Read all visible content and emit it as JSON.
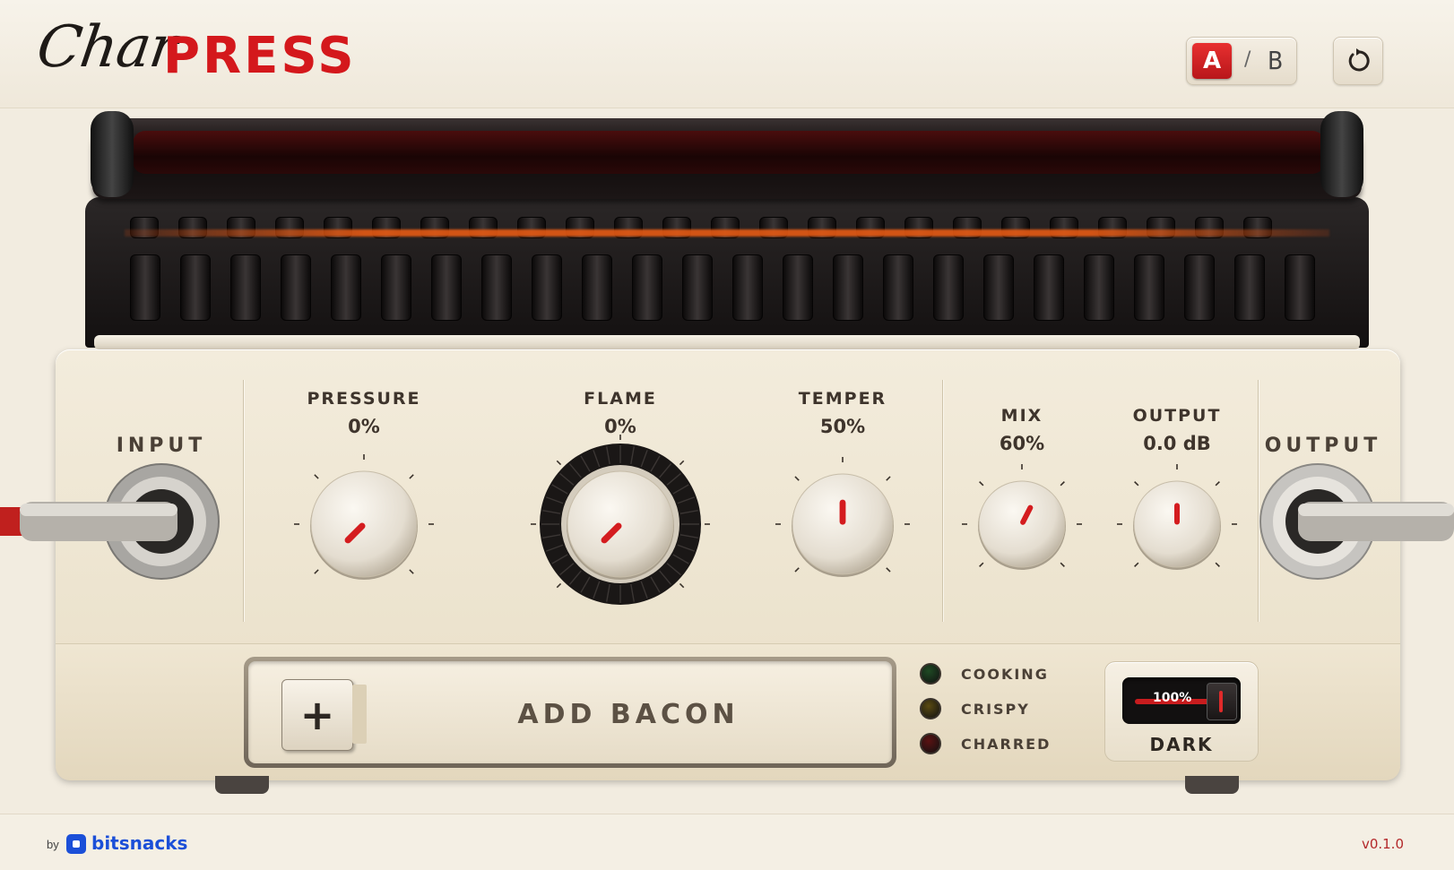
{
  "header": {
    "logo_script": "Char",
    "logo_bold": "PRESS",
    "ab": {
      "a_label": "A",
      "divider": "/",
      "b_label": "B",
      "selected": "A"
    },
    "reset_icon": "reset-icon"
  },
  "panel": {
    "input_label": "INPUT",
    "output_label": "OUTPUT",
    "knobs": {
      "pressure": {
        "label": "PRESSURE",
        "value": "0%",
        "fraction": 0.0
      },
      "flame": {
        "label": "FLAME",
        "value": "0%",
        "fraction": 0.0
      },
      "temper": {
        "label": "TEMPER",
        "value": "50%",
        "fraction": 0.5
      },
      "mix": {
        "label": "MIX",
        "value": "60%",
        "fraction": 0.6
      },
      "output": {
        "label": "OUTPUT",
        "value": "0.0 dB",
        "fraction": 0.5
      }
    },
    "add_bacon": {
      "icon": "plus-icon",
      "plus_glyph": "+",
      "label": "ADD BACON"
    },
    "status": {
      "cooking": {
        "label": "COOKING",
        "color": "#1f4a24"
      },
      "crispy": {
        "label": "CRISPY",
        "color": "#5a4a12"
      },
      "charred": {
        "label": "CHARRED",
        "color": "#5a1212"
      }
    },
    "dark": {
      "value": "100%",
      "fraction": 1.0,
      "label": "DARK"
    }
  },
  "colors": {
    "accent": "#d4181c",
    "brand": "#1b4fd8"
  },
  "footer": {
    "by": "by",
    "brand": "bitsnacks",
    "version": "v0.1.0"
  }
}
